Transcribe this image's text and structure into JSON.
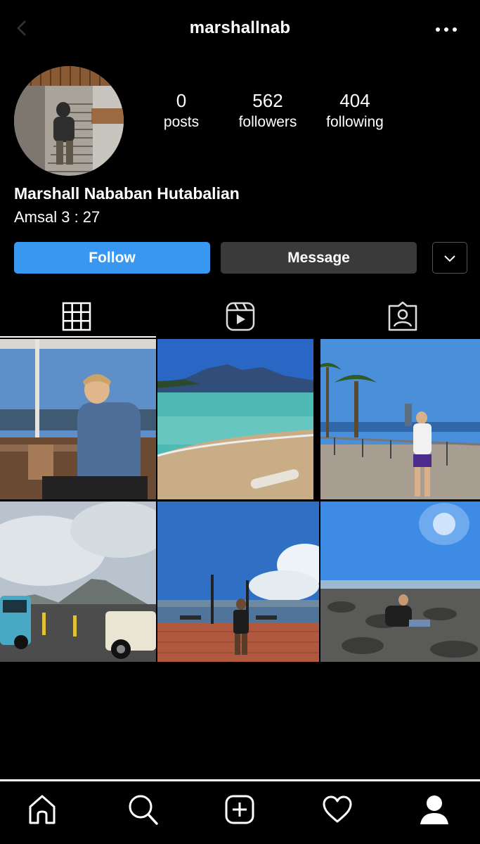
{
  "header": {
    "username": "marshallnab"
  },
  "profile": {
    "full_name": "Marshall Nababan Hutabalian",
    "bio": "Amsal 3 : 27",
    "stats": [
      {
        "value": "0",
        "label": "posts"
      },
      {
        "value": "562",
        "label": "followers"
      },
      {
        "value": "404",
        "label": "following"
      }
    ]
  },
  "actions": {
    "follow_label": "Follow",
    "message_label": "Message"
  },
  "tabs": [
    {
      "name": "grid-icon",
      "active": true
    },
    {
      "name": "reels-icon",
      "active": false
    },
    {
      "name": "tagged-icon",
      "active": false
    }
  ],
  "bottom_nav": [
    {
      "name": "home-icon"
    },
    {
      "name": "search-icon"
    },
    {
      "name": "new-post-icon"
    },
    {
      "name": "activity-heart-icon"
    },
    {
      "name": "profile-icon"
    }
  ],
  "colors": {
    "follow_button": "#3897f0",
    "message_button": "#3a3a3a",
    "background": "#000000"
  }
}
